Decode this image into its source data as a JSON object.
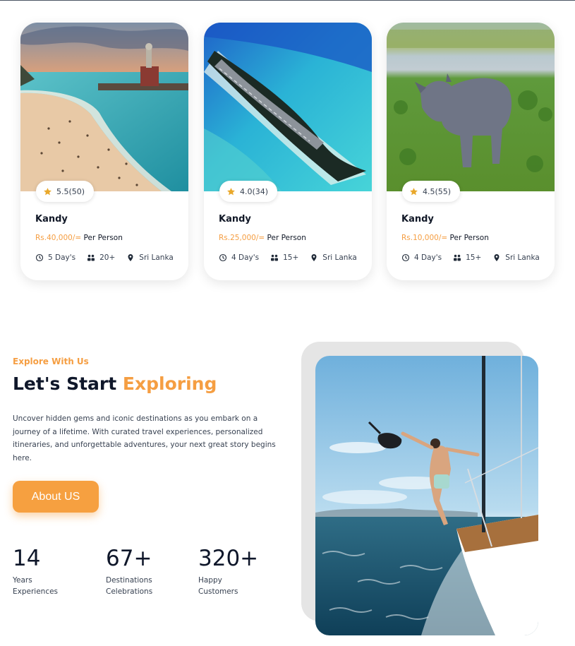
{
  "cards": [
    {
      "title": "Kandy",
      "rating": "5.5(50)",
      "price": "Rs.40,000/=",
      "price_suffix": "Per Person",
      "duration": "5 Day's",
      "group": "20+",
      "location": "Sri Lanka",
      "image": "beach-statue-photo"
    },
    {
      "title": "Kandy",
      "rating": "4.0(34)",
      "price": "Rs.25,000/=",
      "price_suffix": "Per Person",
      "duration": "4 Day's",
      "group": "15+",
      "location": "Sri Lanka",
      "image": "island-runway-photo"
    },
    {
      "title": "Kandy",
      "rating": "4.5(55)",
      "price": "Rs.10,000/=",
      "price_suffix": "Per Person",
      "duration": "4 Day's",
      "group": "15+",
      "location": "Sri Lanka",
      "image": "rhino-photo"
    }
  ],
  "explore": {
    "eyebrow": "Explore With Us",
    "headline": "Let's Start",
    "headline_accent": "Exploring",
    "description": "Uncover hidden gems and iconic destinations as you embark on a journey of a lifetime. With curated travel experiences, personalized itineraries, and unforgettable adventures, your next great story begins here.",
    "cta_label": "About US",
    "stats": [
      {
        "value": "14",
        "label_line1": "Years",
        "label_line2": "Experiences"
      },
      {
        "value": "67+",
        "label_line1": "Destinations",
        "label_line2": "Celebrations"
      },
      {
        "value": "320+",
        "label_line1": "Happy",
        "label_line2": "Customers"
      }
    ],
    "hero_image": "sailboat-photo"
  },
  "icons": {
    "rating": "star-icon",
    "duration": "clock-icon",
    "group": "users-icon",
    "location": "map-pin-icon"
  },
  "colors": {
    "accent": "#f59e42",
    "button": "#f6a040",
    "heading": "#0f172a",
    "text": "#374151",
    "star": "#e9a82b"
  }
}
